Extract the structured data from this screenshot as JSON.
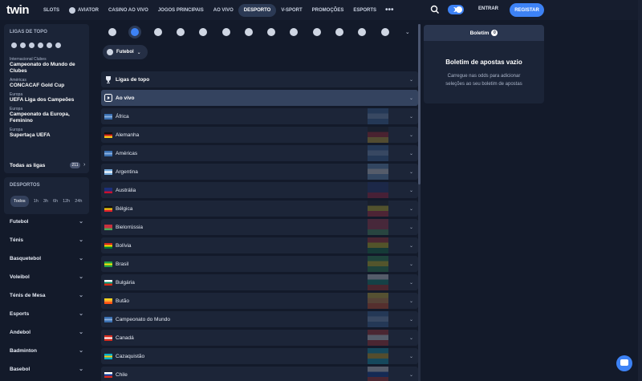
{
  "brand": {
    "logo": "twin",
    "accent": "#3d82f5"
  },
  "topnav": {
    "items": [
      "SLOTS",
      "AVIATOR",
      "CASINO AO VIVO",
      "JOGOS PRINCIPAIS",
      "AO VIVO",
      "DESPORTO",
      "V-SPORT",
      "PROMOÇÕES",
      "ESPORTS"
    ],
    "active": "DESPORTO",
    "more": "•••",
    "login": "ENTRAR",
    "register": "REGISTAR"
  },
  "sidebar": {
    "top_leagues_title": "LIGAS DE TOPO",
    "top_leagues": [
      {
        "region": "Internacional Clubes",
        "name": "Campeonato do Mundo de Clubes"
      },
      {
        "region": "Américas",
        "name": "CONCACAF Gold Cup"
      },
      {
        "region": "Europa",
        "name": "UEFA Liga dos Campeões"
      },
      {
        "region": "Europa",
        "name": "Campeonato da Europa, Feminino"
      },
      {
        "region": "Europa",
        "name": "Supertaça UEFA"
      }
    ],
    "all_leagues": "Todas as ligas",
    "all_leagues_count": "211",
    "sports_title": "DESPORTOS",
    "time_filters": [
      "Todos",
      "1h",
      "3h",
      "6h",
      "12h",
      "24h"
    ],
    "sports": [
      "Futebol",
      "Ténis",
      "Basquetebol",
      "Voleibol",
      "Ténis de Mesa",
      "Esports",
      "Andebol",
      "Badminton",
      "Basebol"
    ]
  },
  "sport_filter": {
    "label": "Futebol"
  },
  "list": {
    "special": [
      {
        "label": "Ligas de topo"
      },
      {
        "label": "Ao vivo"
      }
    ],
    "countries": [
      {
        "label": "África",
        "flag": [
          "#3a6fb0",
          "#8ab0e0",
          "#3a6fb0"
        ]
      },
      {
        "label": "Alemanha",
        "flag": [
          "#111111",
          "#d11919",
          "#f2c21b"
        ]
      },
      {
        "label": "Américas",
        "flag": [
          "#3a6fb0",
          "#8ab0e0",
          "#3a6fb0"
        ]
      },
      {
        "label": "Argentina",
        "flag": [
          "#75aadb",
          "#ffffff",
          "#75aadb"
        ]
      },
      {
        "label": "Austrália",
        "flag": [
          "#1c2f7a",
          "#1c2f7a",
          "#c8102e"
        ]
      },
      {
        "label": "Bélgica",
        "flag": [
          "#111111",
          "#f6d80b",
          "#e0232b"
        ]
      },
      {
        "label": "Bielorrússia",
        "flag": [
          "#c8313e",
          "#c8313e",
          "#4aa657"
        ]
      },
      {
        "label": "Bolívia",
        "flag": [
          "#d52b1e",
          "#f9e300",
          "#007934"
        ]
      },
      {
        "label": "Brasil",
        "flag": [
          "#229e45",
          "#f8e509",
          "#229e45"
        ]
      },
      {
        "label": "Bulgária",
        "flag": [
          "#ffffff",
          "#00966e",
          "#d62612"
        ]
      },
      {
        "label": "Butão",
        "flag": [
          "#ffd520",
          "#ff9933",
          "#ff4e12"
        ]
      },
      {
        "label": "Campeonato do Mundo",
        "flag": [
          "#3a6fb0",
          "#8ab0e0",
          "#3a6fb0"
        ]
      },
      {
        "label": "Canadá",
        "flag": [
          "#d52b1e",
          "#ffffff",
          "#d52b1e"
        ]
      },
      {
        "label": "Cazaquistão",
        "flag": [
          "#00afca",
          "#fec50c",
          "#00afca"
        ]
      },
      {
        "label": "Chile",
        "flag": [
          "#ffffff",
          "#0039a6",
          "#d52b1e"
        ]
      }
    ]
  },
  "betslip": {
    "tab": "Boletim",
    "count": "0",
    "title": "Boletim de apostas vazio",
    "subtitle": "Carregue nas odds para adicionar seleções ao seu boletim de apostas"
  }
}
